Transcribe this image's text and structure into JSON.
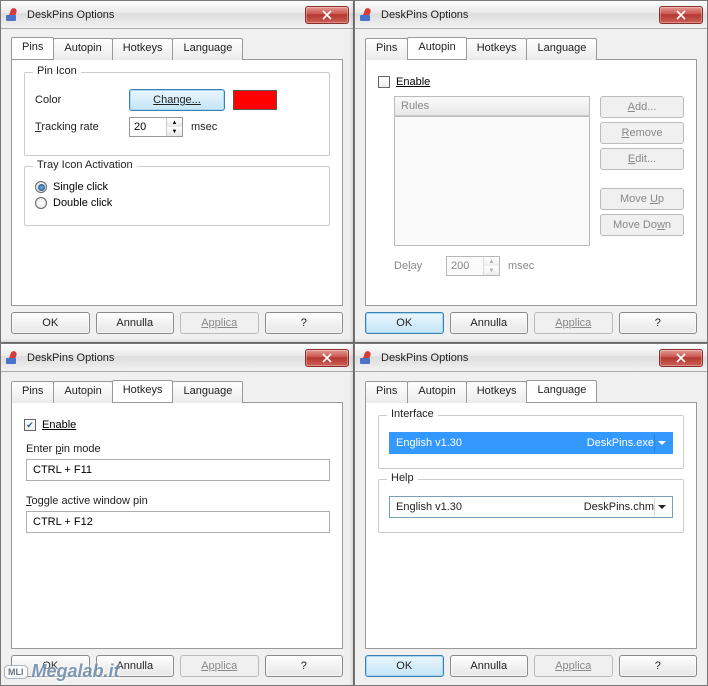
{
  "title": "DeskPins Options",
  "tabs": {
    "pins": "Pins",
    "autopin": "Autopin",
    "hotkeys": "Hotkeys",
    "language": "Language"
  },
  "buttons": {
    "ok": "OK",
    "cancel": "Annulla",
    "apply": "Applica",
    "help": "?"
  },
  "pinsTab": {
    "pinIcon": "Pin Icon",
    "color": "Color",
    "change": "Change...",
    "swatch": "#ff0000",
    "trackingRate": "Tracking rate",
    "trackingValue": "20",
    "msec": "msec",
    "trayIcon": "Tray Icon Activation",
    "single": "Single click",
    "double": "Double click"
  },
  "autopinTab": {
    "enable": "Enable",
    "rules": "Rules",
    "add": "Add...",
    "remove": "Remove",
    "edit": "Edit...",
    "moveUp": "Move Up",
    "moveDown": "Move Down",
    "delay": "Delay",
    "delayValue": "200",
    "msec": "msec"
  },
  "hotkeysTab": {
    "enable": "Enable",
    "enterPin": "Enter pin mode",
    "enterPinVal": "CTRL + F11",
    "toggle": "Toggle active window pin",
    "toggleVal": "CTRL + F12"
  },
  "languageTab": {
    "interface": "Interface",
    "ifaceVal": "English v1.30",
    "ifaceFile": "DeskPins.exe",
    "help": "Help",
    "helpVal": "English v1.30",
    "helpFile": "DeskPins.chm"
  },
  "watermark": {
    "badge": "MLI",
    "text": "Megalab.it"
  }
}
